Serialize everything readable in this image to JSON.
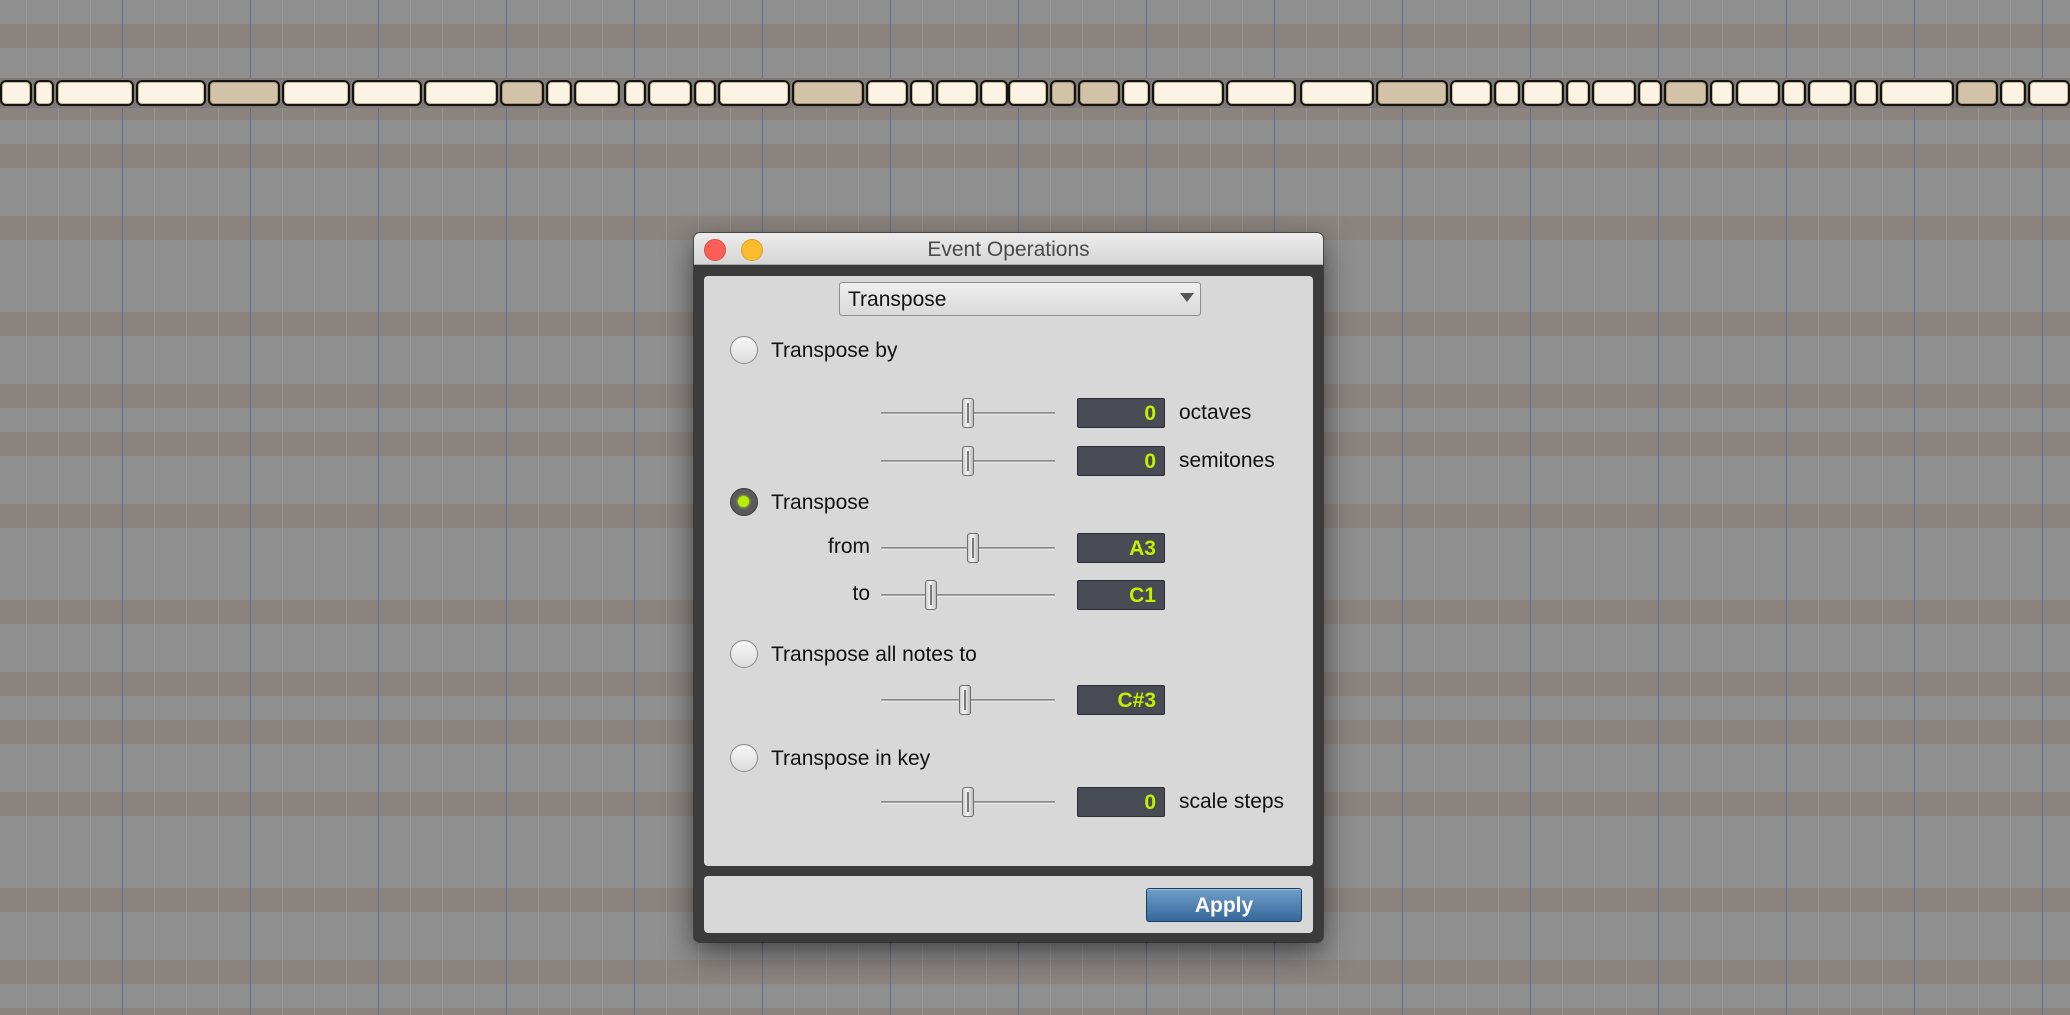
{
  "dialog": {
    "title": "Event Operations",
    "operation_selector": {
      "selected": "Transpose"
    },
    "options": [
      {
        "id": "transpose-by",
        "label": "Transpose by",
        "selected": false,
        "rows": [
          {
            "value": "0",
            "unit": "octaves",
            "level": 0.5
          },
          {
            "value": "0",
            "unit": "semitones",
            "level": 0.5
          }
        ]
      },
      {
        "id": "transpose-from-to",
        "label": "Transpose",
        "selected": true,
        "rows": [
          {
            "label": "from",
            "value": "A3",
            "level": 0.53
          },
          {
            "label": "to",
            "value": "C1",
            "level": 0.27
          }
        ]
      },
      {
        "id": "transpose-all-notes-to",
        "label": "Transpose all notes to",
        "selected": false,
        "rows": [
          {
            "value": "C#3",
            "level": 0.48
          }
        ]
      },
      {
        "id": "transpose-in-key",
        "label": "Transpose in key",
        "selected": false,
        "rows": [
          {
            "value": "0",
            "unit": "scale steps",
            "level": 0.5
          }
        ]
      }
    ],
    "apply_label": "Apply"
  },
  "colors": {
    "value_text": "#c4f000",
    "value_background": "#484b53",
    "radio_selected_dot": "#b6f000",
    "apply_button": "#4a7db0",
    "close_button": "#fc5f57",
    "minimize_button": "#fdbc2e",
    "note_normal": "#fbf4e4",
    "note_muted": "#d2c2a8"
  },
  "icons": {
    "close": "close-icon",
    "minimize": "minimize-icon",
    "dropdown": "chevron-down-icon"
  }
}
